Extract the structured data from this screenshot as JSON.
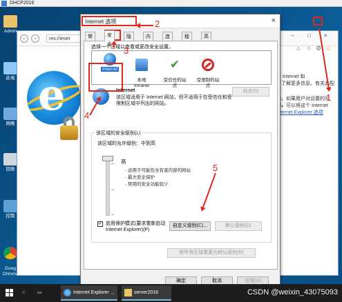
{
  "vm": {
    "title": "DHCP2016"
  },
  "desktop": {
    "icons": [
      {
        "label": "Admin"
      },
      {
        "label": "此电"
      },
      {
        "label": "网络"
      },
      {
        "label": "回收"
      },
      {
        "label": "控制"
      },
      {
        "label": "Goog\nChrome"
      }
    ]
  },
  "browser": {
    "url": "res://ieset",
    "side_text": [
      "击 Internet 和",
      "要了解更多信息。有关此配置",
      "问，如果用户对设置的问题，",
      "器，可以将这个 Internet",
      "Internet Explorer 选项"
    ]
  },
  "dialog": {
    "title": "Internet 选项",
    "close": "×",
    "tabs": [
      "常规",
      "安全",
      "隐私",
      "内容",
      "连接",
      "程序",
      "高级"
    ],
    "zone_prompt": "选择一个区域以查看或更改安全设置。",
    "zones": [
      {
        "label": "Internet",
        "icon": "globe-icon"
      },
      {
        "label": "本地\nIntranet",
        "icon": "intranet-icon"
      },
      {
        "label": "受信任的站\n点",
        "icon": "check-icon"
      },
      {
        "label": "受限制的站\n点",
        "icon": "no-entry-icon"
      }
    ],
    "zone_heading": "Internet",
    "zone_desc": "该区域适用于 Internet 网站，但不适用于在受信任和受限制区域中列出的网站。",
    "sites_button": "站点(S)",
    "security_level_group": "该区域的安全级别(L)",
    "allowed_levels": "该区域的允许级别：中到高",
    "level_name": "高",
    "level_bullets": [
      "- 适用于可能包含有害内容的网站",
      "- 最大安全保护",
      "- 禁用的安全功能较少"
    ],
    "protected_mode": "启用保护模式(要求重新启动 Internet Explorer)(P)",
    "custom_level_button": "自定义级别(C)...",
    "default_level_button": "默认级别(D)",
    "reset_all_button": "将所有区域重置为默认级别(R)",
    "ok_button": "确定",
    "cancel_button": "取消",
    "apply_button": "应用(A)"
  },
  "annotations": [
    "1",
    "2",
    "3",
    "4",
    "5"
  ],
  "taskbar": {
    "items": [
      "Internet Explorer ...",
      "server2016"
    ],
    "watermark": "CSDN @weixin_43075093"
  },
  "colors": {
    "annotation": "#e0261a",
    "selection": "#1f6fd1",
    "desktop": "#0c5e99"
  }
}
